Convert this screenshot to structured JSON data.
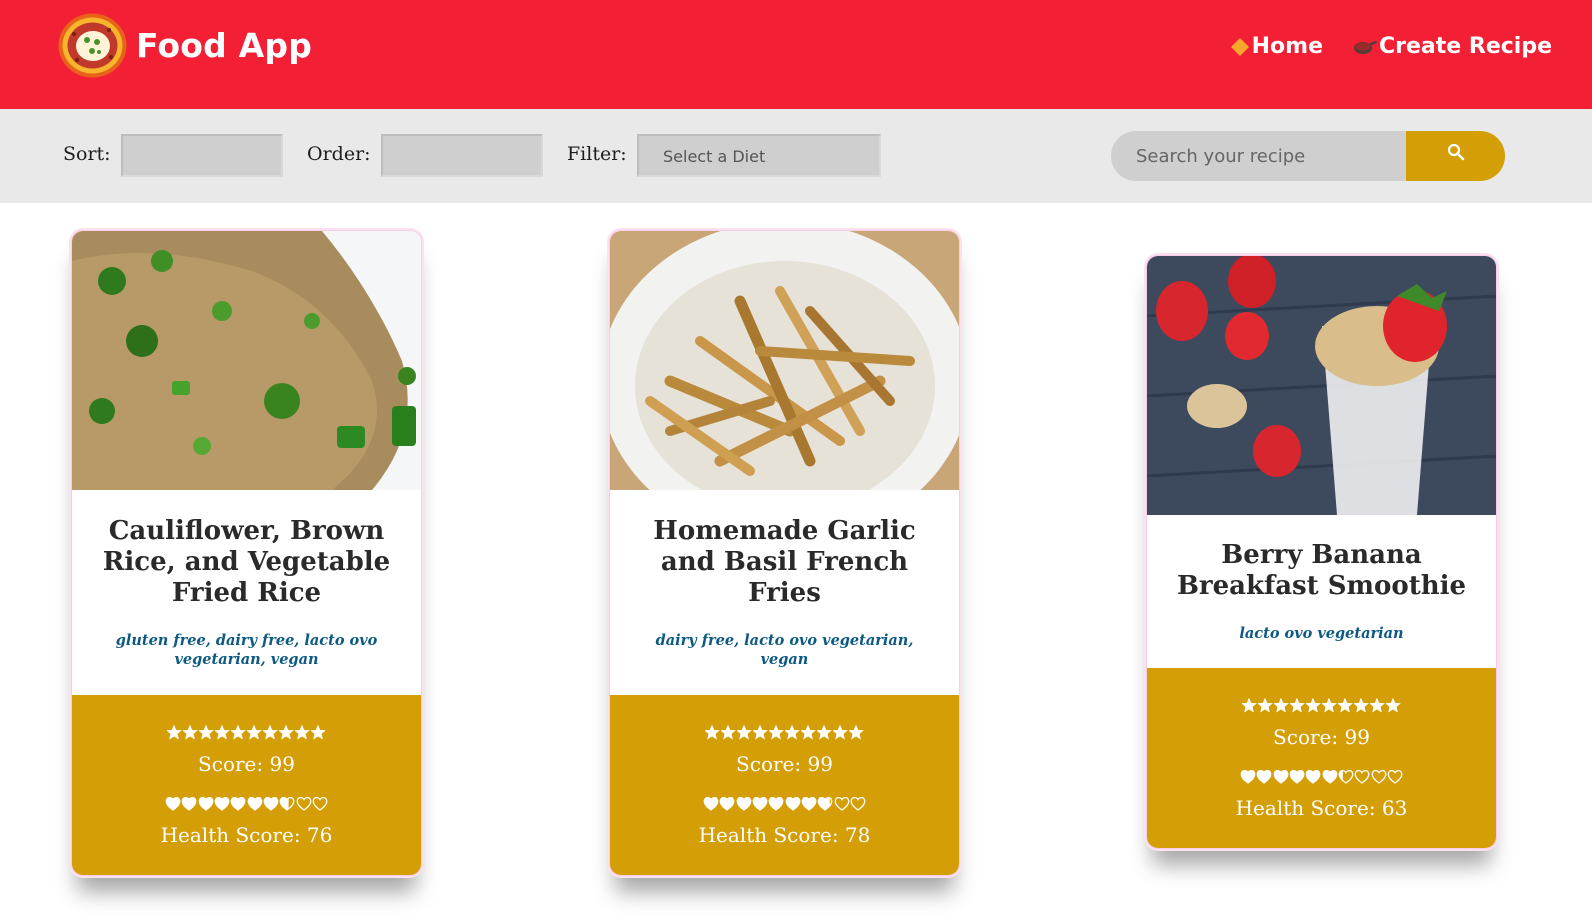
{
  "header": {
    "brand": "Food App",
    "nav": [
      {
        "label": "Home",
        "icon": "home-icon"
      },
      {
        "label": "Create Recipe",
        "icon": "frying-pan-icon"
      }
    ],
    "background": "#f21f35"
  },
  "toolbar": {
    "sort_label": "Sort:",
    "sort_value": "",
    "order_label": "Order:",
    "order_value": "",
    "filter_label": "Filter:",
    "filter_value": "Select a Diet",
    "search_placeholder": "Search your recipe",
    "accent": "#d49e07"
  },
  "recipes": [
    {
      "title": "Cauliflower, Brown Rice, and Vegetable Fried Rice",
      "diets": "gluten free, dairy free, lacto ovo vegetarian, vegan",
      "score_label": "Score: 99",
      "score": 99,
      "health_label": "Health Score: 76",
      "health_score": 76,
      "image": "fried-rice-photo"
    },
    {
      "title": "Homemade Garlic and Basil French Fries",
      "diets": "dairy free, lacto ovo vegetarian, vegan",
      "score_label": "Score: 99",
      "score": 99,
      "health_label": "Health Score: 78",
      "health_score": 78,
      "image": "french-fries-photo"
    },
    {
      "title": "Berry Banana Breakfast Smoothie",
      "diets": "lacto ovo vegetarian",
      "score_label": "Score: 99",
      "score": 99,
      "health_label": "Health Score: 63",
      "health_score": 63,
      "image": "smoothie-photo"
    }
  ]
}
